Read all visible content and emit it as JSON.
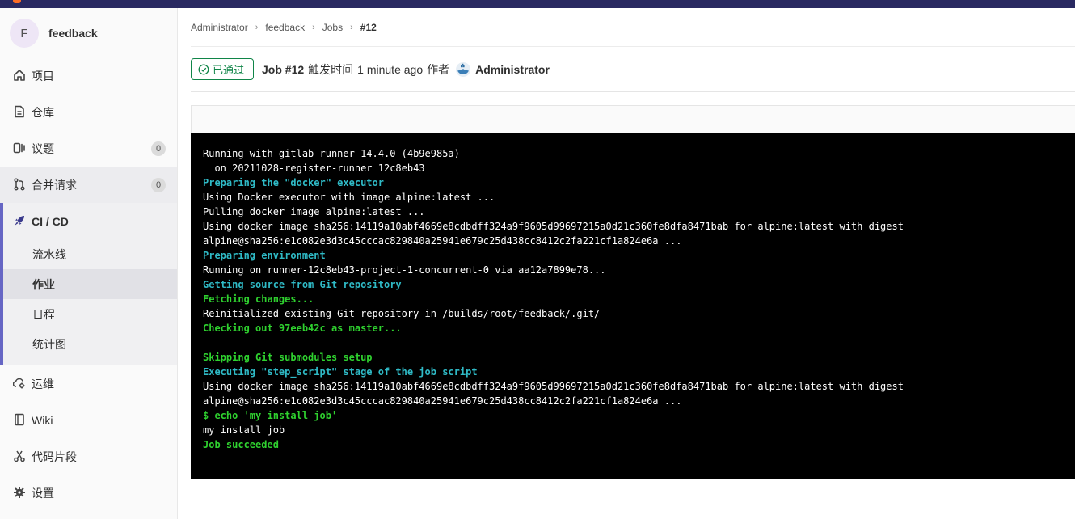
{
  "project": {
    "initial": "F",
    "name": "feedback"
  },
  "sidebar": {
    "items": [
      {
        "label": "项目",
        "icon": "home-icon"
      },
      {
        "label": "仓库",
        "icon": "document-icon"
      },
      {
        "label": "议题",
        "icon": "issues-icon",
        "count": "0"
      },
      {
        "label": "合并请求",
        "icon": "merge-request-icon",
        "count": "0"
      },
      {
        "label": "CI / CD",
        "icon": "rocket-icon"
      },
      {
        "label": "运维",
        "icon": "cloud-gear-icon"
      },
      {
        "label": "Wiki",
        "icon": "book-icon"
      },
      {
        "label": "代码片段",
        "icon": "scissors-icon"
      },
      {
        "label": "设置",
        "icon": "gear-icon"
      }
    ],
    "cicd_sub": [
      "流水线",
      "作业",
      "日程",
      "统计图"
    ]
  },
  "breadcrumb": [
    "Administrator",
    "feedback",
    "Jobs",
    "#12"
  ],
  "job": {
    "status": "已通过",
    "title": "Job #12",
    "triggered_label": "触发时间",
    "time": "1 minute ago",
    "author_label": "作者",
    "author": "Administrator"
  },
  "colors": {
    "success": "#108548",
    "sidebar_accent": "#6666c4",
    "log_cyan": "#2fbac6",
    "log_green": "#2fd12f"
  },
  "log": [
    {
      "text": "Running with gitlab-runner 14.4.0 (4b9e985a)",
      "style": "plain"
    },
    {
      "text": "  on 20211028-register-runner 12c8eb43",
      "style": "plain"
    },
    {
      "text": "Preparing the \"docker\" executor",
      "style": "cyan"
    },
    {
      "text": "Using Docker executor with image alpine:latest ...",
      "style": "plain"
    },
    {
      "text": "Pulling docker image alpine:latest ...",
      "style": "plain"
    },
    {
      "text": "Using docker image sha256:14119a10abf4669e8cdbdff324a9f9605d99697215a0d21c360fe8dfa8471bab for alpine:latest with digest",
      "style": "plain"
    },
    {
      "text": "alpine@sha256:e1c082e3d3c45cccac829840a25941e679c25d438cc8412c2fa221cf1a824e6a ...",
      "style": "plain"
    },
    {
      "text": "Preparing environment",
      "style": "cyan"
    },
    {
      "text": "Running on runner-12c8eb43-project-1-concurrent-0 via aa12a7899e78...",
      "style": "plain"
    },
    {
      "text": "Getting source from Git repository",
      "style": "cyan"
    },
    {
      "text": "Fetching changes...",
      "style": "green"
    },
    {
      "text": "Reinitialized existing Git repository in /builds/root/feedback/.git/",
      "style": "plain"
    },
    {
      "text": "Checking out 97eeb42c as master...",
      "style": "green"
    },
    {
      "text": "",
      "style": "plain"
    },
    {
      "text": "Skipping Git submodules setup",
      "style": "green"
    },
    {
      "text": "Executing \"step_script\" stage of the job script",
      "style": "cyan"
    },
    {
      "text": "Using docker image sha256:14119a10abf4669e8cdbdff324a9f9605d99697215a0d21c360fe8dfa8471bab for alpine:latest with digest",
      "style": "plain"
    },
    {
      "text": "alpine@sha256:e1c082e3d3c45cccac829840a25941e679c25d438cc8412c2fa221cf1a824e6a ...",
      "style": "plain"
    },
    {
      "text": "$ echo 'my install job'",
      "style": "green"
    },
    {
      "text": "my install job",
      "style": "plain"
    },
    {
      "text": "Job succeeded",
      "style": "green"
    }
  ]
}
